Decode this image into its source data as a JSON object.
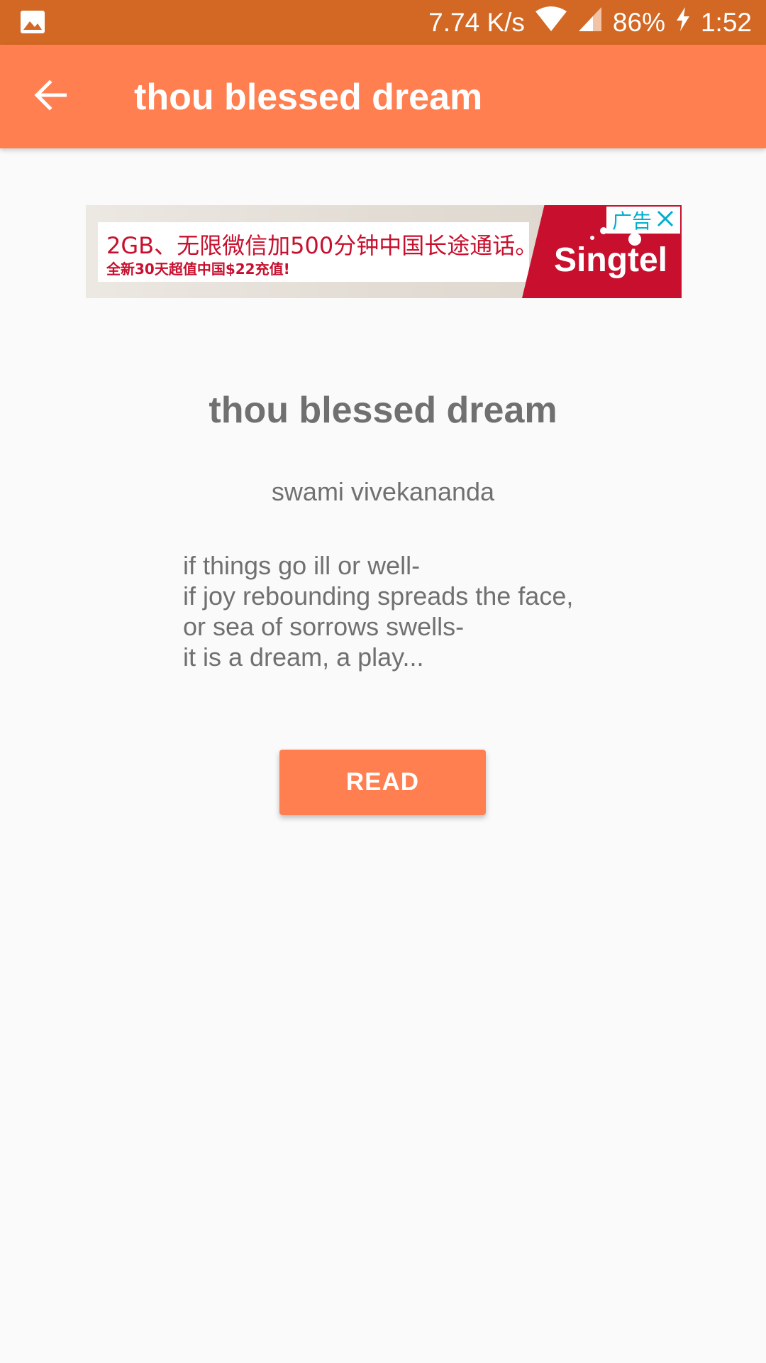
{
  "status_bar": {
    "network_speed": "7.74 K/s",
    "battery": "86%",
    "time": "1:52",
    "icons": [
      "image-icon",
      "wifi-icon",
      "signal-icon",
      "charging-icon"
    ]
  },
  "app_bar": {
    "title": "thou blessed dream",
    "back_icon": "arrow-back-icon"
  },
  "ad": {
    "headline": "2GB、无限微信加500分钟中国长途通话。",
    "subline": "全新30天超值中国$22充值!",
    "brand": "Singtel",
    "label": "广告",
    "close_icon": "close-icon"
  },
  "poem": {
    "title": "thou blessed dream",
    "author": "swami vivekananda",
    "lines": [
      "if things go ill or well-",
      "if joy rebounding spreads the face,",
      "or sea of sorrows swells-",
      "it is a dream, a play..."
    ]
  },
  "actions": {
    "read_label": "READ"
  },
  "colors": {
    "status_bar": "#d26823",
    "app_bar": "#ff7f50",
    "button": "#ff7f50",
    "text_gray": "#707070",
    "background": "#fafafa"
  }
}
